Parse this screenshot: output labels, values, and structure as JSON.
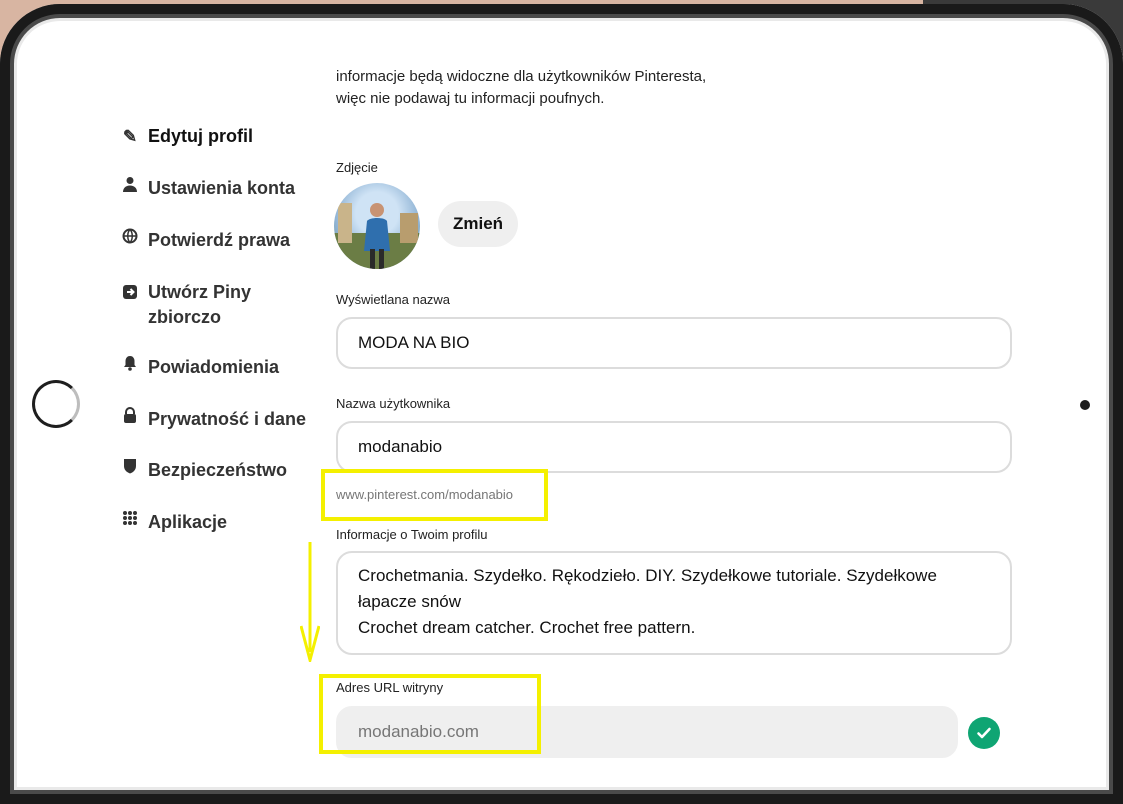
{
  "sidebar": {
    "items": [
      {
        "label": "Edytuj profil",
        "icon": "pencil-icon",
        "active": true
      },
      {
        "label": "Ustawienia konta",
        "icon": "person-icon"
      },
      {
        "label": "Potwierdź prawa",
        "icon": "globe-icon"
      },
      {
        "label": "Utwórz Piny zbiorczo",
        "icon": "import-icon"
      },
      {
        "label": "Powiadomienia",
        "icon": "bell-icon"
      },
      {
        "label": "Prywatność i dane",
        "icon": "lock-icon"
      },
      {
        "label": "Bezpieczeństwo",
        "icon": "shield-icon"
      },
      {
        "label": "Aplikacje",
        "icon": "apps-grid-icon"
      }
    ]
  },
  "main": {
    "intro_line1": "informacje będą widoczne dla użytkowników Pinteresta,",
    "intro_line2": "więc nie podawaj tu informacji poufnych.",
    "photo_label": "Zdjęcie",
    "change_button": "Zmień",
    "display_name_label": "Wyświetlana nazwa",
    "display_name_value": "MODA NA BIO",
    "username_label": "Nazwa użytkownika",
    "username_value": "modanabio",
    "username_helper": "www.pinterest.com/modanabio",
    "about_label": "Informacje o Twoim profilu",
    "about_line1": "Crochetmania. Szydełko. Rękodzieło. DIY. Szydełkowe tutoriale. Szydełkowe",
    "about_line2": "łapacze snów",
    "about_line3": "Crochet dream catcher. Crochet free pattern.",
    "website_label": "Adres URL witryny",
    "website_value": "modanabio.com"
  },
  "colors": {
    "highlight": "#f4f000",
    "verified": "#0fa573"
  }
}
